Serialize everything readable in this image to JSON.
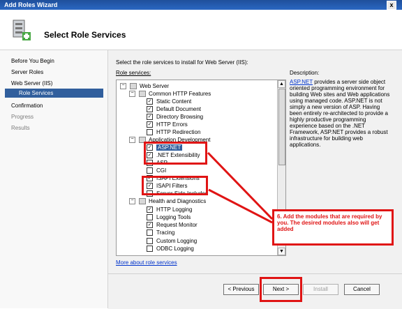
{
  "window": {
    "title": "Add Roles Wizard",
    "close_glyph": "x",
    "page_title": "Select Role Services"
  },
  "sidebar": {
    "items": [
      {
        "label": "Before You Begin"
      },
      {
        "label": "Server Roles"
      },
      {
        "label": "Web Server (IIS)"
      },
      {
        "label": "Role Services"
      },
      {
        "label": "Confirmation"
      },
      {
        "label": "Progress"
      },
      {
        "label": "Results"
      }
    ]
  },
  "content": {
    "select_text": "Select the role services to install for Web Server (IIS):",
    "role_label": "Role services:",
    "description_label": "Description:",
    "description_link": "ASP.NET",
    "description_text": "provides a server side object oriented programming environment for building Web sites and Web applications using managed code. ASP.NET is not simply a new version of ASP. Having been entirely re-architected to provide a highly productive programming experience based on the .NET Framework, ASP.NET provides a robust infrastructure for building web applications.",
    "more_link": "More about role services"
  },
  "tree": {
    "items": [
      {
        "label": "Web Server",
        "check": "",
        "expander": "−"
      },
      {
        "label": "Common HTTP Features",
        "check": "",
        "expander": "−"
      },
      {
        "label": "Static Content",
        "check": "✓"
      },
      {
        "label": "Default Document",
        "check": "✓"
      },
      {
        "label": "Directory Browsing",
        "check": "✓"
      },
      {
        "label": "HTTP Errors",
        "check": "✓"
      },
      {
        "label": "HTTP Redirection",
        "check": ""
      },
      {
        "label": "Application Development",
        "check": "",
        "expander": "−"
      },
      {
        "label": "ASP.NET",
        "check": "✓"
      },
      {
        "label": ".NET Extensibility",
        "check": "✓"
      },
      {
        "label": "ASP",
        "check": ""
      },
      {
        "label": "CGI",
        "check": ""
      },
      {
        "label": "ISAPI Extensions",
        "check": "✓"
      },
      {
        "label": "ISAPI Filters",
        "check": "✓"
      },
      {
        "label": "Server Side Includes",
        "check": ""
      },
      {
        "label": "Health and Diagnostics",
        "check": "",
        "expander": "−"
      },
      {
        "label": "HTTP Logging",
        "check": "✓"
      },
      {
        "label": "Logging Tools",
        "check": ""
      },
      {
        "label": "Request Monitor",
        "check": "✓"
      },
      {
        "label": "Tracing",
        "check": ""
      },
      {
        "label": "Custom Logging",
        "check": ""
      },
      {
        "label": "ODBC Logging",
        "check": ""
      }
    ]
  },
  "buttons": {
    "previous": "< Previous",
    "next": "Next >",
    "install": "Install",
    "cancel": "Cancel"
  },
  "annotation": {
    "text": "6. Add the modules that are required by you. The desired modules also will get added"
  }
}
